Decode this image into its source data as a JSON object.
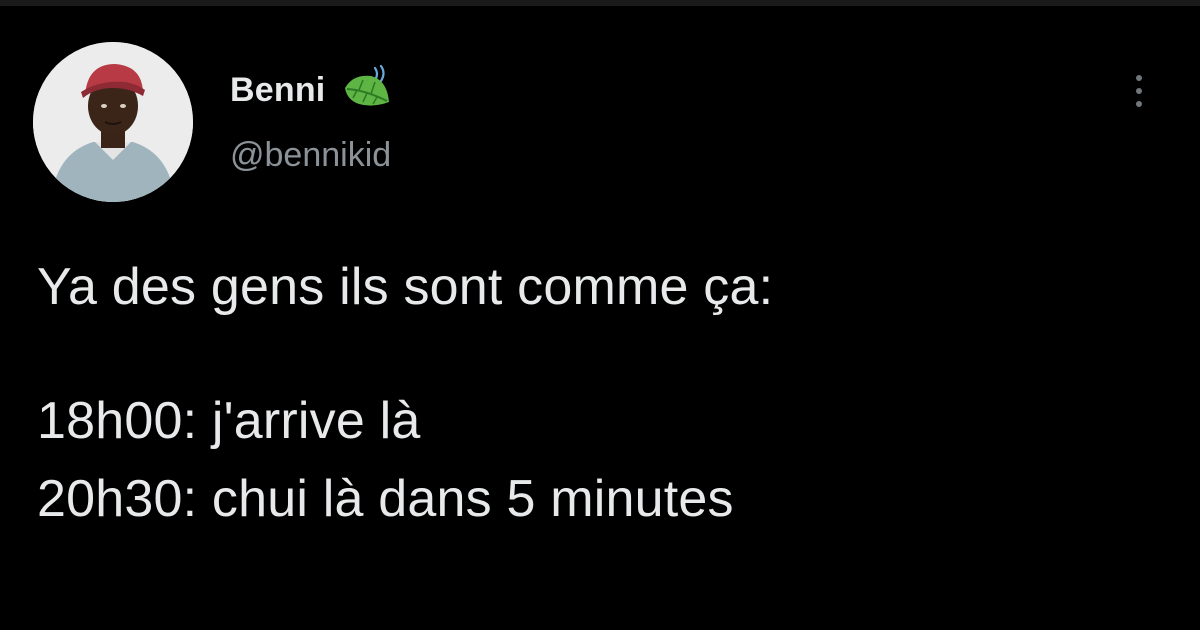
{
  "author": {
    "display_name": "Benni",
    "handle": "@bennikid",
    "badge_icon": "leaf-icon",
    "avatar_icon": "avatar-photo"
  },
  "menu_icon": "more-vertical-icon",
  "tweet": {
    "lines": [
      "Ya des gens ils sont comme ça:",
      "",
      "18h00: j'arrive là",
      "20h30: chui là dans 5 minutes"
    ]
  },
  "colors": {
    "background": "#000000",
    "text_primary": "#e7e9ea",
    "text_secondary": "#8b9298",
    "leaf_green": "#5fb544"
  }
}
